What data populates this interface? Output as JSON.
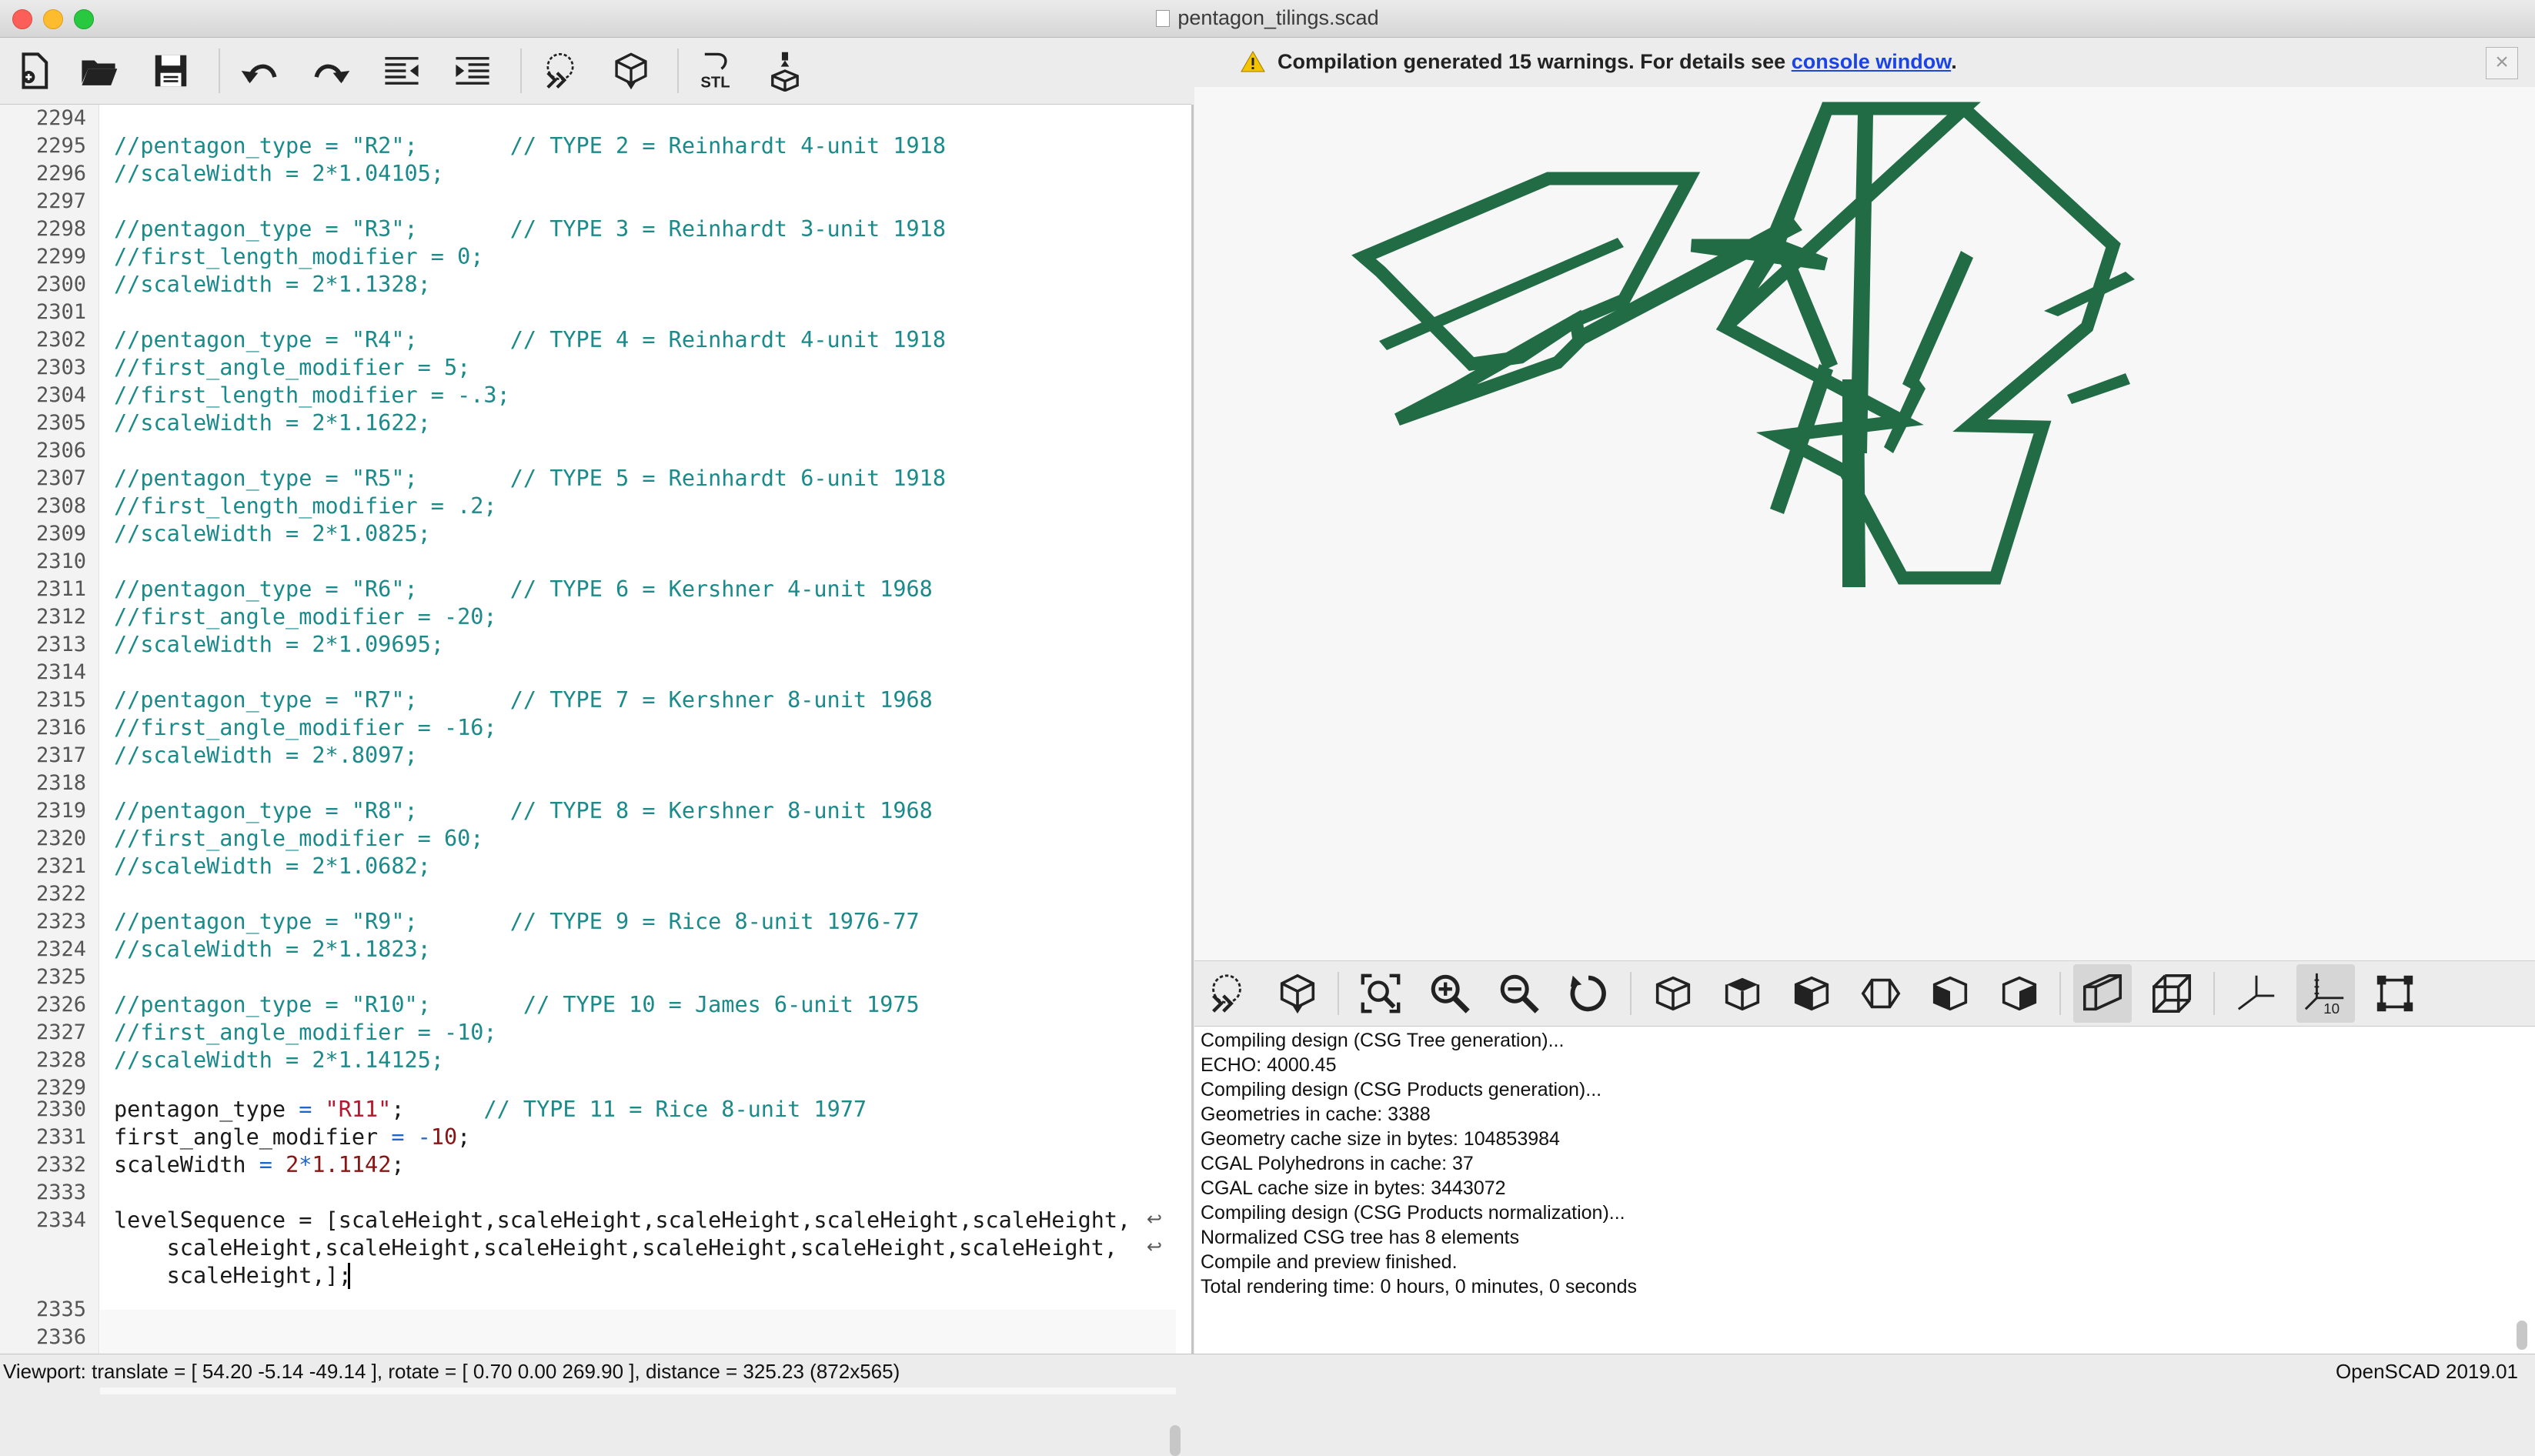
{
  "window": {
    "title": "pentagon_tilings.scad"
  },
  "editor_toolbar": {
    "buttons": [
      "new-file",
      "open-file",
      "save-file",
      "undo",
      "redo",
      "unindent",
      "indent",
      "preview",
      "render",
      "export-stl",
      "send-to-3d-print"
    ],
    "stl_label": "STL"
  },
  "editor": {
    "lines": [
      {
        "num": "2294",
        "text": ""
      },
      {
        "num": "2295",
        "text": "//pentagon_type = \"R2\";       // TYPE 2 = Reinhardt 4-unit 1918"
      },
      {
        "num": "2296",
        "text": "//scaleWidth = 2*1.04105;"
      },
      {
        "num": "2297",
        "text": ""
      },
      {
        "num": "2298",
        "text": "//pentagon_type = \"R3\";       // TYPE 3 = Reinhardt 3-unit 1918"
      },
      {
        "num": "2299",
        "text": "//first_length_modifier = 0;"
      },
      {
        "num": "2300",
        "text": "//scaleWidth = 2*1.1328;"
      },
      {
        "num": "2301",
        "text": ""
      },
      {
        "num": "2302",
        "text": "//pentagon_type = \"R4\";       // TYPE 4 = Reinhardt 4-unit 1918"
      },
      {
        "num": "2303",
        "text": "//first_angle_modifier = 5;"
      },
      {
        "num": "2304",
        "text": "//first_length_modifier = -.3;"
      },
      {
        "num": "2305",
        "text": "//scaleWidth = 2*1.1622;"
      },
      {
        "num": "2306",
        "text": ""
      },
      {
        "num": "2307",
        "text": "//pentagon_type = \"R5\";       // TYPE 5 = Reinhardt 6-unit 1918"
      },
      {
        "num": "2308",
        "text": "//first_length_modifier = .2;"
      },
      {
        "num": "2309",
        "text": "//scaleWidth = 2*1.0825;"
      },
      {
        "num": "2310",
        "text": ""
      },
      {
        "num": "2311",
        "text": "//pentagon_type = \"R6\";       // TYPE 6 = Kershner 4-unit 1968"
      },
      {
        "num": "2312",
        "text": "//first_angle_modifier = -20;"
      },
      {
        "num": "2313",
        "text": "//scaleWidth = 2*1.09695;"
      },
      {
        "num": "2314",
        "text": ""
      },
      {
        "num": "2315",
        "text": "//pentagon_type = \"R7\";       // TYPE 7 = Kershner 8-unit 1968"
      },
      {
        "num": "2316",
        "text": "//first_angle_modifier = -16;"
      },
      {
        "num": "2317",
        "text": "//scaleWidth = 2*.8097;"
      },
      {
        "num": "2318",
        "text": ""
      },
      {
        "num": "2319",
        "text": "//pentagon_type = \"R8\";       // TYPE 8 = Kershner 8-unit 1968"
      },
      {
        "num": "2320",
        "text": "//first_angle_modifier = 60;"
      },
      {
        "num": "2321",
        "text": "//scaleWidth = 2*1.0682;"
      },
      {
        "num": "2322",
        "text": ""
      },
      {
        "num": "2323",
        "text": "//pentagon_type = \"R9\";       // TYPE 9 = Rice 8-unit 1976-77"
      },
      {
        "num": "2324",
        "text": "//scaleWidth = 2*1.1823;"
      },
      {
        "num": "2325",
        "text": ""
      },
      {
        "num": "2326",
        "text": "//pentagon_type = \"R10\";       // TYPE 10 = James 6-unit 1975"
      },
      {
        "num": "2327",
        "text": "//first_angle_modifier = -10;"
      },
      {
        "num": "2328",
        "text": "//scaleWidth = 2*1.14125;"
      },
      {
        "num": "2329",
        "text": ""
      }
    ],
    "active_lines": {
      "l2330": {
        "num": "2330",
        "kw": "pentagon_type ",
        "op": "= ",
        "str": "\"R11\"",
        "rest": ";      ",
        "cmt": "// TYPE 11 = Rice 8-unit 1977"
      },
      "l2331": {
        "num": "2331",
        "kw": "first_angle_modifier ",
        "op": "= -",
        "num_val": "10",
        "rest": ";"
      },
      "l2332": {
        "num": "2332",
        "kw": "scaleWidth ",
        "op": "= ",
        "n1": "2",
        "star": "*",
        "n2": "1.1142",
        "rest": ";"
      },
      "l2333": {
        "num": "2333"
      },
      "l2334": {
        "num": "2334",
        "row1": "levelSequence = [scaleHeight,scaleHeight,scaleHeight,scaleHeight,scaleHeight,",
        "row2": "    scaleHeight,scaleHeight,scaleHeight,scaleHeight,scaleHeight,scaleHeight,",
        "row3": "    scaleHeight,];"
      },
      "l2335": {
        "num": "2335"
      },
      "l2336": {
        "num": "2336"
      }
    },
    "wrap_marker": "↩"
  },
  "warning": {
    "text": "Compilation generated 15 warnings. For details see",
    "link": "console window",
    "suffix": ".",
    "close": "×"
  },
  "viewport": {
    "model_color": "#216b45",
    "background": "#f7f7f7"
  },
  "viewport_toolbar": {
    "buttons": [
      "preview",
      "render",
      "view-all",
      "zoom-in",
      "zoom-out",
      "reset-view",
      "view-right",
      "view-top",
      "view-bottom",
      "view-left",
      "view-front",
      "view-back",
      "perspective",
      "orthogonal",
      "show-axes",
      "show-scale-markers",
      "show-edges"
    ],
    "scale_label": "10"
  },
  "console": {
    "lines": [
      "Compiling design (CSG Tree generation)...",
      "ECHO: 4000.45",
      "Compiling design (CSG Products generation)...",
      "Geometries in cache: 3388",
      "Geometry cache size in bytes: 104853984",
      "CGAL Polyhedrons in cache: 37",
      "CGAL cache size in bytes: 3443072",
      "Compiling design (CSG Products normalization)...",
      "Normalized CSG tree has 8 elements",
      "Compile and preview finished.",
      "Total rendering time: 0 hours, 0 minutes, 0 seconds"
    ]
  },
  "statusbar": {
    "viewport_info": "Viewport: translate = [ 54.20 -5.14 -49.14 ], rotate = [ 0.70 0.00 269.90 ], distance = 325.23 (872x565)",
    "version": "OpenSCAD 2019.01"
  }
}
